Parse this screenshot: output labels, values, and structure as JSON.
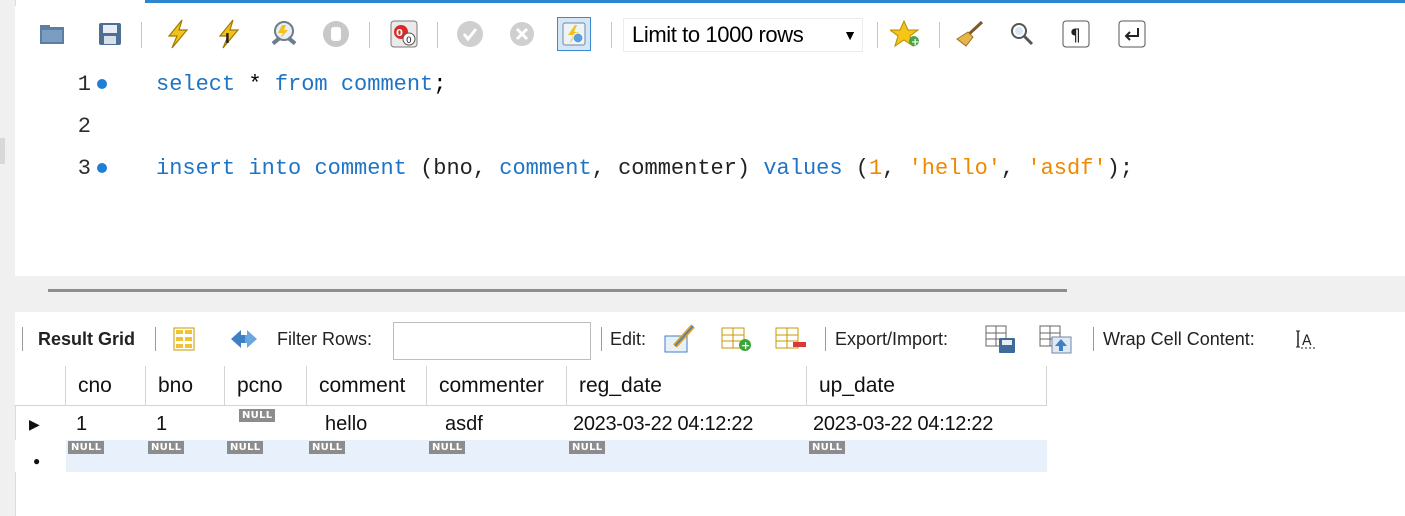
{
  "toolbar": {
    "icons": [
      "open-folder-icon",
      "save-icon",
      "execute-icon",
      "execute-current-icon",
      "explain-icon",
      "stop-icon",
      "toggle-error-stop-icon",
      "commit-icon",
      "rollback-icon",
      "autocommit-icon",
      "beautify-star-icon",
      "broom-icon",
      "search-icon",
      "invisible-chars-icon",
      "wrap-icon"
    ],
    "limit_label": "Limit to 1000 rows"
  },
  "editor": {
    "lines": [
      {
        "number": "1",
        "has_dot": true,
        "code": "select * from comment;"
      },
      {
        "number": "2",
        "has_dot": false,
        "code": ""
      },
      {
        "number": "3",
        "has_dot": true,
        "code": "insert into comment (bno, comment, commenter) values (1, 'hello', 'asdf');"
      }
    ]
  },
  "result_toolbar": {
    "result_grid_label": "Result Grid",
    "filter_rows_label": "Filter Rows:",
    "filter_value": "",
    "edit_label": "Edit:",
    "export_import_label": "Export/Import:",
    "wrap_label": "Wrap Cell Content:"
  },
  "grid": {
    "columns": [
      "cno",
      "bno",
      "pcno",
      "comment",
      "commenter",
      "reg_date",
      "up_date"
    ],
    "rows": [
      [
        "1",
        "1",
        "NULL",
        "hello",
        "asdf",
        "2023-03-22 04:12:22",
        "2023-03-22 04:12:22"
      ],
      [
        "NULL",
        "NULL",
        "NULL",
        "NULL",
        "NULL",
        "NULL",
        "NULL"
      ]
    ],
    "null_text": "NULL"
  },
  "colors": {
    "keyword": "#1f74c4",
    "string": "#f08800",
    "line_dot": "#1f7fd6",
    "selected_row": "#e8f1fb",
    "null_badge": "#8c8c8c"
  }
}
